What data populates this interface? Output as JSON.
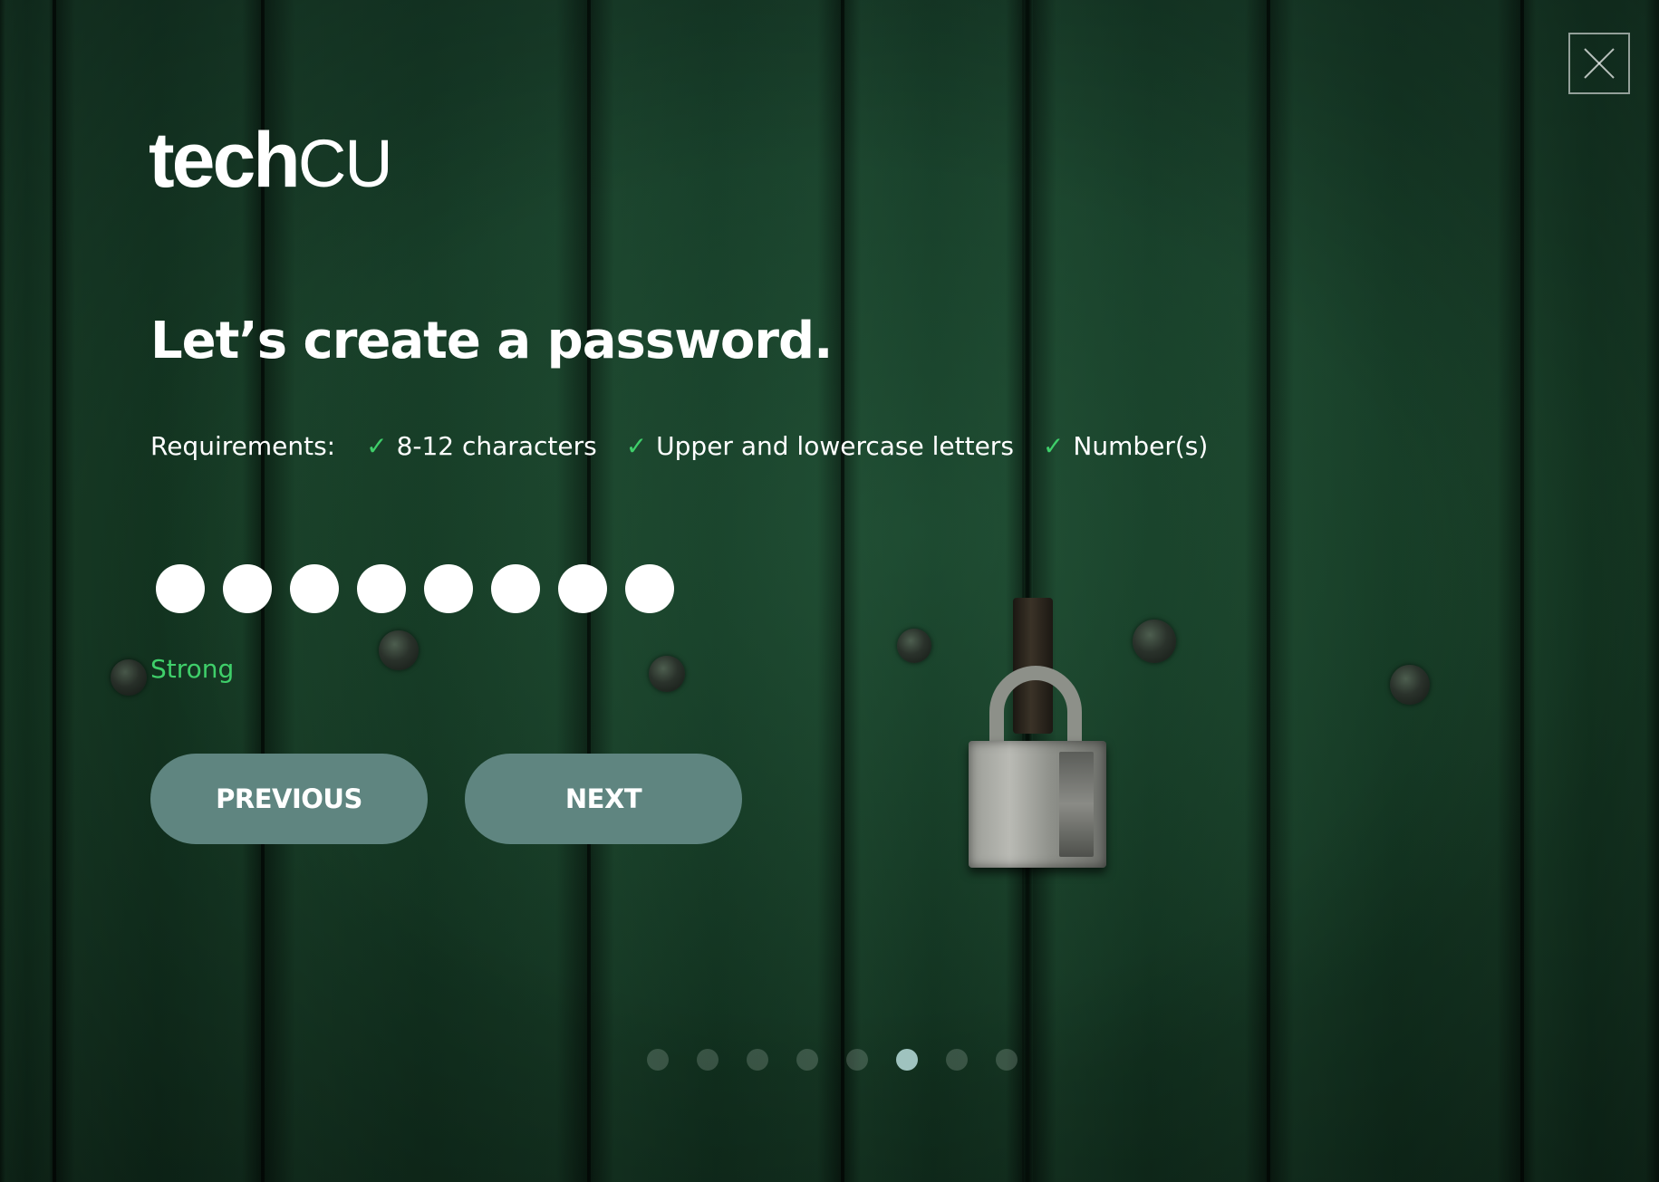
{
  "logo": {
    "part1": "tech",
    "part2": "cu"
  },
  "title": "Let’s create a password.",
  "requirements": {
    "label": "Requirements:",
    "items": [
      {
        "text": "8-12 characters",
        "met": true
      },
      {
        "text": "Upper and lowercase letters",
        "met": true
      },
      {
        "text": "Number(s)",
        "met": true
      }
    ],
    "check_glyph": "✓"
  },
  "password": {
    "masked_length": 8,
    "mask_glyph": "●"
  },
  "strength": {
    "label": "Strong",
    "color": "#3fcf6a"
  },
  "buttons": {
    "previous": "PREVIOUS",
    "next": "NEXT",
    "color": "#5f8580"
  },
  "pager": {
    "total": 8,
    "current": 6
  },
  "close": {
    "icon": "close-icon"
  },
  "colors": {
    "accent_green": "#3fcf6a",
    "background": "#163b28"
  }
}
